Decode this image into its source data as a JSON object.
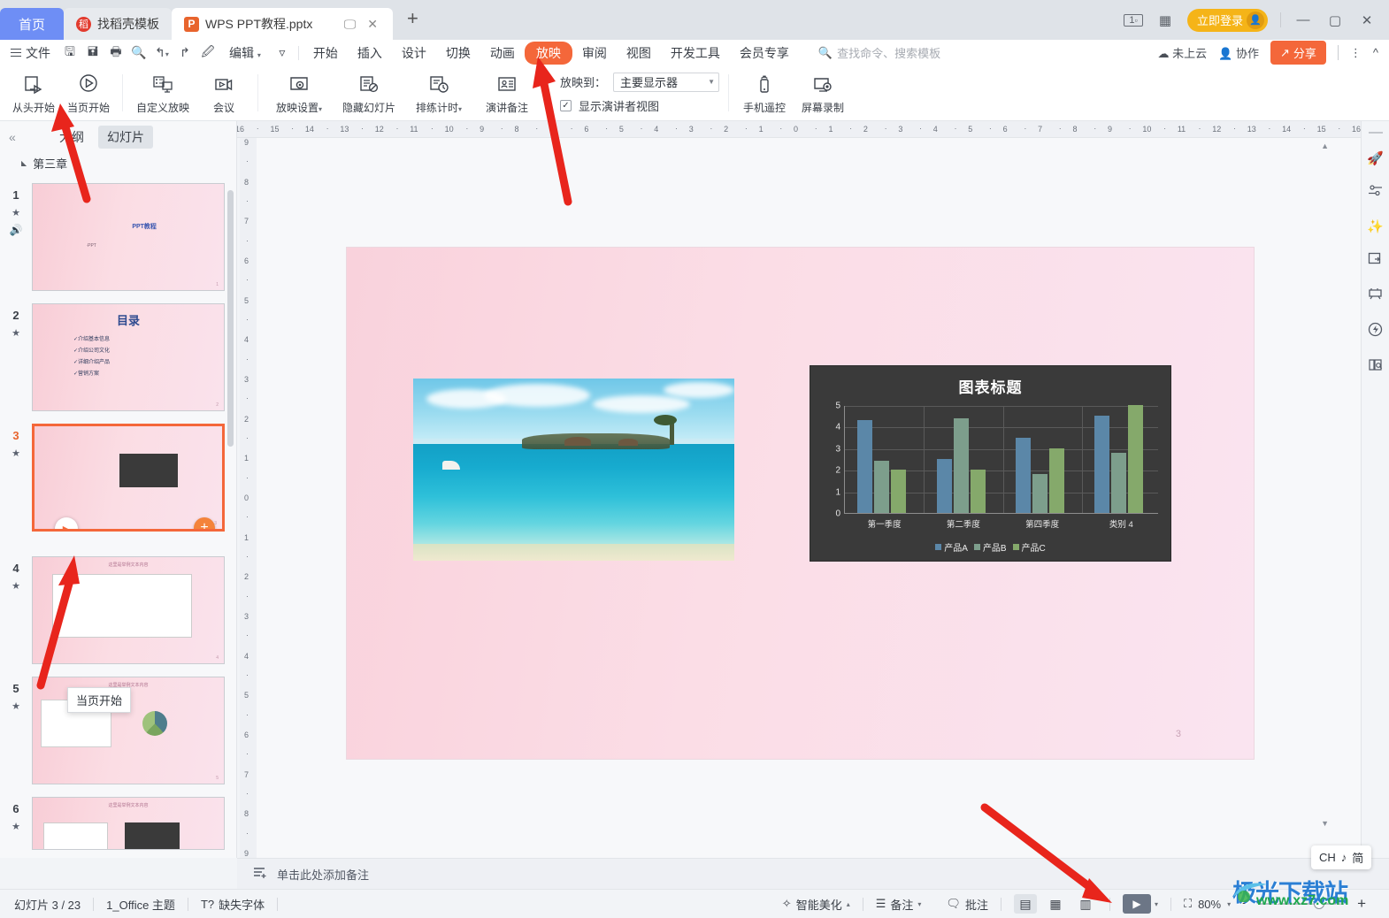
{
  "window": {
    "tabs": [
      {
        "label": "首页",
        "kind": "home"
      },
      {
        "label": "找稻壳模板",
        "kind": "template"
      },
      {
        "label": "WPS PPT教程.pptx",
        "kind": "document",
        "active": true
      }
    ],
    "new_tab": "+",
    "controls": {
      "screens": "1",
      "grid": "grid-icon",
      "login": "立即登录",
      "minimize": "—",
      "maximize": "▢",
      "close": "✕"
    }
  },
  "menu": {
    "file": "文件",
    "quick_access": [
      "save-icon",
      "save-as-icon",
      "print-icon",
      "print-preview-icon",
      "undo-icon",
      "redo-icon",
      "format-painter-icon"
    ],
    "edit": "编辑",
    "items": [
      "开始",
      "插入",
      "设计",
      "切换",
      "动画",
      "放映",
      "审阅",
      "视图",
      "开发工具",
      "会员专享"
    ],
    "active_item": "放映",
    "search_placeholder": "查找命令、搜索模板",
    "cloud_status": "未上云",
    "collab": "协作",
    "share": "分享",
    "more": "⋮",
    "collapse": "^"
  },
  "ribbon": {
    "buttons": [
      {
        "label": "从头开始",
        "icon": "play-from-start-icon",
        "caret": false
      },
      {
        "label": "当页开始",
        "icon": "play-current-icon",
        "caret": false
      },
      {
        "label": "自定义放映",
        "icon": "custom-show-icon",
        "caret": false
      },
      {
        "label": "会议",
        "icon": "meeting-icon",
        "caret": false
      },
      {
        "label": "放映设置",
        "icon": "show-settings-icon",
        "caret": true
      },
      {
        "label": "隐藏幻灯片",
        "icon": "hide-slide-icon",
        "caret": false
      },
      {
        "label": "排练计时",
        "icon": "rehearse-timing-icon",
        "caret": true
      },
      {
        "label": "演讲备注",
        "icon": "speaker-notes-icon",
        "caret": false
      }
    ],
    "project_to_label": "放映到：",
    "project_to_value": "主要显示器",
    "presenter_view_label": "显示演讲者视图",
    "presenter_view_checked": true,
    "right_buttons": [
      {
        "label": "手机遥控",
        "icon": "phone-remote-icon"
      },
      {
        "label": "屏幕录制",
        "icon": "screen-record-icon"
      }
    ]
  },
  "left_panel": {
    "collapse_icon": "chevron-double-left-icon",
    "tabs": [
      {
        "label": "大纲",
        "selected": false
      },
      {
        "label": "幻灯片",
        "selected": true
      }
    ],
    "chapter": "第三章",
    "slides": [
      {
        "num": "1",
        "current": false,
        "kind": "title",
        "title": "PPT教程",
        "sub": "·PPT"
      },
      {
        "num": "2",
        "current": false,
        "kind": "toc",
        "title": "目录",
        "bullets": [
          "介绍基本信息",
          "介绍公司文化",
          "详细介绍产品",
          "营销方案"
        ]
      },
      {
        "num": "3",
        "current": true,
        "kind": "image-chart"
      },
      {
        "num": "4",
        "current": false,
        "kind": "chart-table",
        "heading": "这里是举例文本内容"
      },
      {
        "num": "5",
        "current": false,
        "kind": "bar-pie",
        "heading": "这里是举例文本内容"
      },
      {
        "num": "6",
        "current": false,
        "kind": "two-panel",
        "heading": "这里是举例文本内容"
      }
    ],
    "tooltip": "当页开始",
    "play_icon": "play-icon",
    "add_slide_icon": "plus-icon",
    "add_below_icon": "plus-circle-icon"
  },
  "rulers": {
    "horizontal": [
      "16",
      "15",
      "14",
      "13",
      "12",
      "11",
      "10",
      "9",
      "8",
      "7",
      "6",
      "5",
      "4",
      "3",
      "2",
      "1",
      "0",
      "1",
      "2",
      "3",
      "4",
      "5",
      "6",
      "7",
      "8",
      "9",
      "10",
      "11",
      "12",
      "13",
      "14",
      "15",
      "16"
    ],
    "vertical": [
      "9",
      "8",
      "7",
      "6",
      "5",
      "4",
      "3",
      "2",
      "1",
      "0",
      "1",
      "2",
      "3",
      "4",
      "5",
      "6",
      "7",
      "8",
      "9"
    ]
  },
  "slide": {
    "page_number": "3",
    "image_alt": "tropical-beach-photo",
    "chart_data": {
      "type": "bar",
      "title": "图表标题",
      "categories": [
        "第一季度",
        "第二季度",
        "第四季度",
        "类别 4"
      ],
      "series": [
        {
          "name": "产品A",
          "color": "#5b87a8",
          "values": [
            4.3,
            2.5,
            3.5,
            4.5
          ]
        },
        {
          "name": "产品B",
          "color": "#7d9e8c",
          "values": [
            2.4,
            4.4,
            1.8,
            2.8
          ]
        },
        {
          "name": "产品C",
          "color": "#85a96b",
          "values": [
            2.0,
            2.0,
            3.0,
            5.0
          ]
        }
      ],
      "ylim": [
        0,
        5
      ],
      "yticks": [
        "0",
        "1",
        "2",
        "3",
        "4",
        "5"
      ],
      "xlabel": "",
      "ylabel": "",
      "grid": true,
      "legend_position": "bottom",
      "background": "#3a3a3a"
    }
  },
  "right_rail": {
    "icons": [
      "rocket-icon",
      "sliders-icon",
      "sparkle-star-icon",
      "duplicate-icon",
      "stage-icon",
      "lightning-idea-icon",
      "book-search-icon"
    ]
  },
  "notes": {
    "icon": "add-note-icon",
    "placeholder": "单击此处添加备注"
  },
  "status": {
    "slide_count": "幻灯片 3 / 23",
    "theme": "1_Office 主题",
    "missing_font": "缺失字体",
    "missing_font_icon": "font-warning-icon",
    "beautify": "智能美化",
    "notes_btn": "备注",
    "comment_btn": "批注",
    "views": [
      {
        "name": "normal-view",
        "icon": "▤",
        "selected": true
      },
      {
        "name": "slide-sorter-view",
        "icon": "▦",
        "selected": false
      },
      {
        "name": "reading-view",
        "icon": "▥",
        "selected": false
      }
    ],
    "play_btn": "▶",
    "fit_icon": "fit-slide-icon",
    "zoom": "80%",
    "zoom_out": "−",
    "zoom_in": "+"
  },
  "floating": {
    "ime": {
      "lang": "CH",
      "mode_icon": "♪",
      "simplified": "简"
    },
    "watermark_cn": "极光下载站",
    "watermark_url": "www.xz7.com"
  }
}
